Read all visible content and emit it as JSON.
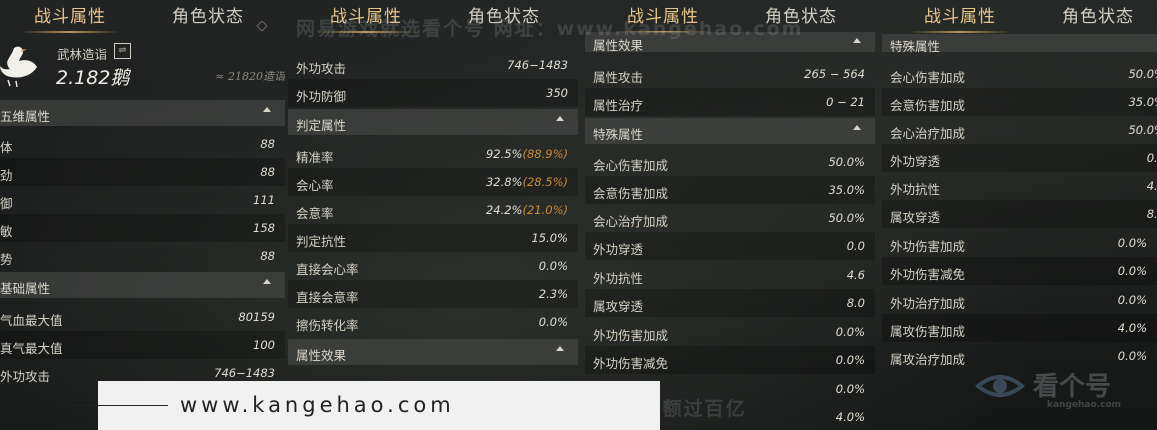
{
  "tabs": {
    "combat": "战斗属性",
    "status": "角色状态"
  },
  "panel1": {
    "sect_name": "武林造诣",
    "swap_icon": "swap-icon",
    "value": "2.182鹅",
    "approx": "≈ 21820造诣",
    "section_five": "五维属性",
    "five": [
      {
        "label": "体",
        "value": "88"
      },
      {
        "label": "劲",
        "value": "88"
      },
      {
        "label": "御",
        "value": "111"
      },
      {
        "label": "敏",
        "value": "158"
      },
      {
        "label": "势",
        "value": "88"
      }
    ],
    "section_basic": "基础属性",
    "basic": [
      {
        "label": "气血最大值",
        "value": "80159"
      },
      {
        "label": "真气最大值",
        "value": "100"
      },
      {
        "label": "外功攻击",
        "value": "746−1483"
      }
    ]
  },
  "panel2": {
    "top_rows": [
      {
        "label": "外功攻击",
        "value": "746−1483"
      },
      {
        "label": "外功防御",
        "value": "350"
      }
    ],
    "section_judge": "判定属性",
    "judge": [
      {
        "label": "精准率",
        "value": "92.5%",
        "sub": "(88.9%)"
      },
      {
        "label": "会心率",
        "value": "32.8%",
        "sub": "(28.5%)"
      },
      {
        "label": "会意率",
        "value": "24.2%",
        "sub": "(21.0%)"
      },
      {
        "label": "判定抗性",
        "value": "15.0%",
        "sub": ""
      },
      {
        "label": "直接会心率",
        "value": "0.0%",
        "sub": ""
      },
      {
        "label": "直接会意率",
        "value": "2.3%",
        "sub": ""
      },
      {
        "label": "擦伤转化率",
        "value": "0.0%",
        "sub": ""
      }
    ],
    "section_attr": "属性效果"
  },
  "panel3": {
    "section_attr": "属性效果",
    "attr": [
      {
        "label": "属性攻击",
        "value": "265 − 564"
      },
      {
        "label": "属性治疗",
        "value": "0 − 21"
      }
    ],
    "section_special": "特殊属性",
    "special": [
      {
        "label": "会心伤害加成",
        "value": "50.0%"
      },
      {
        "label": "会意伤害加成",
        "value": "35.0%"
      },
      {
        "label": "会心治疗加成",
        "value": "50.0%"
      },
      {
        "label": "外功穿透",
        "value": "0.0"
      },
      {
        "label": "外功抗性",
        "value": "4.6"
      },
      {
        "label": "属攻穿透",
        "value": "8.0"
      },
      {
        "label": "外功伤害加成",
        "value": "0.0%"
      },
      {
        "label": "外功伤害减免",
        "value": "0.0%"
      }
    ],
    "extra_values": [
      "0.0%",
      "4.0%"
    ]
  },
  "panel4": {
    "section_special": "特殊属性",
    "rows": [
      {
        "label": "会心伤害加成",
        "value": "50.0%"
      },
      {
        "label": "会意伤害加成",
        "value": "35.0%"
      },
      {
        "label": "会心治疗加成",
        "value": "50.0%"
      },
      {
        "label": "外功穿透",
        "value": "0.0"
      },
      {
        "label": "外功抗性",
        "value": "4.6"
      },
      {
        "label": "属攻穿透",
        "value": "8.0"
      },
      {
        "label": "外功伤害加成",
        "value": "0.0%"
      },
      {
        "label": "外功伤害减免",
        "value": "0.0%"
      },
      {
        "label": "外功治疗加成",
        "value": "0.0%"
      },
      {
        "label": "属攻伤害加成",
        "value": "4.0%"
      },
      {
        "label": "属攻治疗加成",
        "value": "0.0%"
      }
    ]
  },
  "watermarks": {
    "top": "网易游戏就选看个号  网址：www.kangehao.com",
    "bottom": "看个号专业网易游戏八年  年交易额过百亿",
    "logo_text": "看个号",
    "logo_sub": "kangehao.com"
  },
  "footer": {
    "url": "www.kangehao.com"
  }
}
